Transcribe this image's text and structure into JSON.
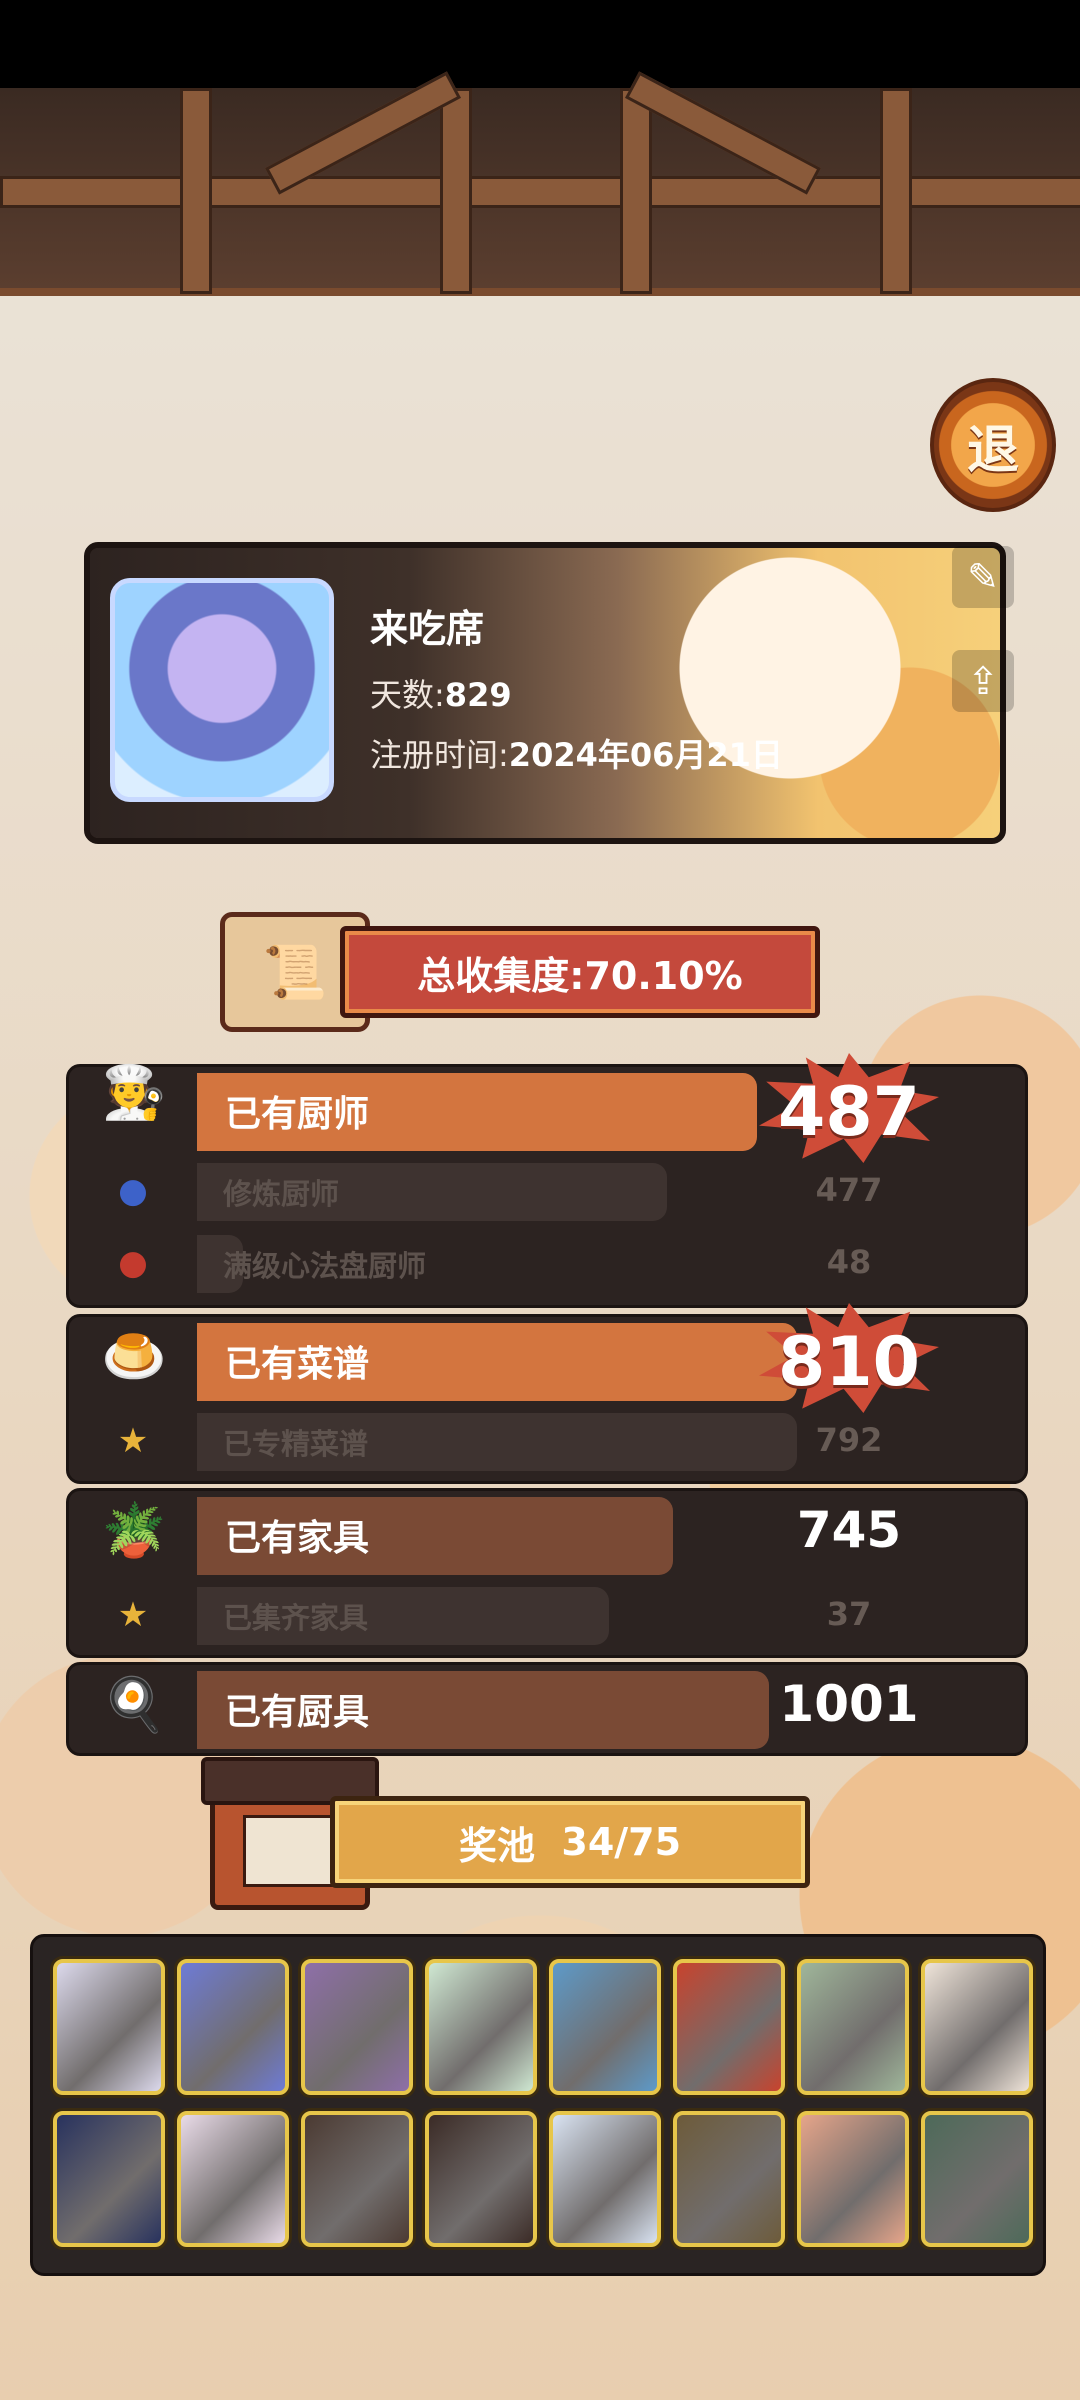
{
  "exit_label": "退",
  "profile": {
    "name": "来吃席",
    "days_label": "天数:",
    "days_value": "829",
    "reg_label": "注册时间:",
    "reg_value": "2024年06月21日"
  },
  "total_collection": "总收集度:70.10%",
  "categories": [
    {
      "label": "已有厨师",
      "count": "487",
      "fill": 0.98,
      "highlight": true,
      "subs": [
        {
          "label": "修炼厨师",
          "count": "477",
          "fill": 0.98
        },
        {
          "label": "满级心法盘厨师",
          "count": "48",
          "fill": 0.1
        }
      ]
    },
    {
      "label": "已有菜谱",
      "count": "810",
      "fill": 1.0,
      "highlight": true,
      "subs": [
        {
          "label": "已专精菜谱",
          "count": "792",
          "fill": 0.98
        }
      ]
    },
    {
      "label": "已有家具",
      "count": "745",
      "fill": 0.7,
      "highlight": false,
      "subs": [
        {
          "label": "已集齐家具",
          "count": "37",
          "fill": 0.05
        }
      ]
    },
    {
      "label": "已有厨具",
      "count": "1001",
      "fill": 0.46,
      "highlight": false,
      "subs": []
    }
  ],
  "pool": {
    "label": "奖池",
    "value": "34/75"
  },
  "pool_cards": [
    "#dcd9ec",
    "#6e7bd6",
    "#8e6fa8",
    "#cfe8d2",
    "#5d9ac9",
    "#c8432d",
    "#9fb69a",
    "#efe4d9",
    "#28325e",
    "#e9dbe8",
    "#4b3a32",
    "#3b2b26",
    "#d9e3f2",
    "#6d5b3a",
    "#e6a58a",
    "#4d6a59"
  ],
  "colors": {
    "accent_orange": "#d3753f",
    "accent_red": "#c4493c",
    "gold": "#e2a64a"
  }
}
